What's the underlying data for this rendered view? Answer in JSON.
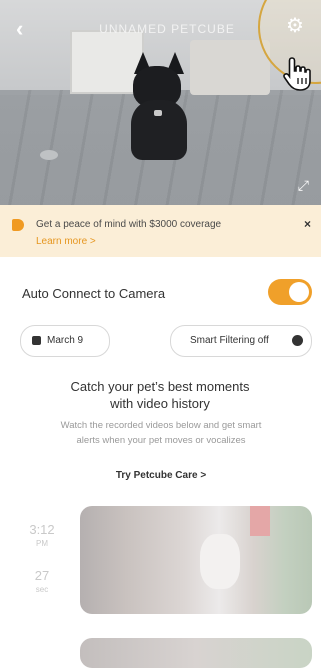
{
  "feed": {
    "title": "UNNAMED PETCUBE",
    "back_icon": "chevron-left-icon",
    "settings_icon": "gear-icon",
    "fullscreen_icon": "expand-icon"
  },
  "banner": {
    "text": "Get a peace of mind with $3000 coverage",
    "link": "Learn more",
    "link_arrow": ">",
    "close": "×",
    "accent": "#f09a22"
  },
  "auto_connect": {
    "label": "Auto Connect to Camera",
    "enabled": true,
    "color": "#f0a02a"
  },
  "filters": {
    "date": "March 9",
    "smart": "Smart Filtering off"
  },
  "empty_state": {
    "title": "Catch your pet’s best moments with video history",
    "description": "Watch the recorded videos below and get smart alerts when your pet moves or vocalizes",
    "cta": "Try Petcube Care",
    "cta_arrow": ">"
  },
  "history": [
    {
      "time": "3:12",
      "period": "PM",
      "duration": "27",
      "duration_unit": "sec"
    }
  ]
}
